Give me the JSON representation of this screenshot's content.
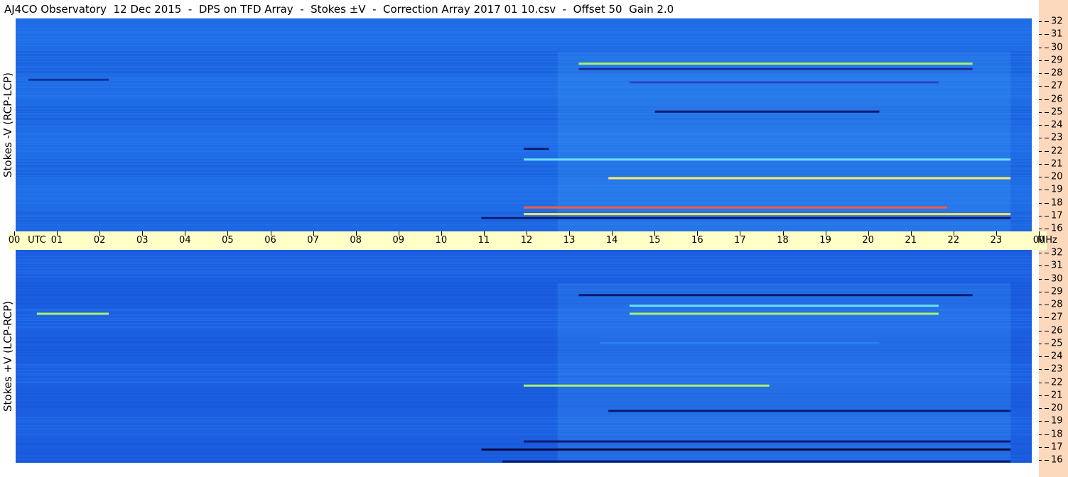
{
  "title": "AJ4CO Observatory  12 Dec 2015  -  DPS on TFD Array  -  Stokes ±V  -  Correction Array 2017 01 10.csv  -  Offset 50  Gain 2.0",
  "chart_data": [
    {
      "type": "heatmap",
      "ylabel": "Stokes -V (RCP-LCP)",
      "y_ticks": [
        "32",
        "31",
        "30",
        "29",
        "28",
        "27",
        "26",
        "25",
        "24",
        "23",
        "22",
        "21",
        "20",
        "19",
        "18",
        "17",
        "16"
      ],
      "ylim": [
        16,
        32
      ],
      "x_ticks": [
        "00",
        "01",
        "02",
        "03",
        "04",
        "05",
        "06",
        "07",
        "08",
        "09",
        "10",
        "11",
        "12",
        "13",
        "14",
        "15",
        "16",
        "17",
        "18",
        "19",
        "20",
        "21",
        "22",
        "23",
        "00"
      ],
      "xlim": [
        0,
        24
      ],
      "background_color": "#1f6de6",
      "features": [
        {
          "t_start": 13.3,
          "t_end": 22.6,
          "f": 28.6,
          "color": "#a8f26b"
        },
        {
          "t_start": 13.3,
          "t_end": 22.6,
          "f": 28.2,
          "color": "#1a2fa0"
        },
        {
          "t_start": 14.5,
          "t_end": 21.8,
          "f": 27.2,
          "color": "#2845c8"
        },
        {
          "t_start": 15.1,
          "t_end": 20.4,
          "f": 25.0,
          "color": "#0a1a70"
        },
        {
          "t_start": 12.0,
          "t_end": 12.6,
          "f": 22.2,
          "color": "#0a1a70"
        },
        {
          "t_start": 12.0,
          "t_end": 23.5,
          "f": 21.4,
          "color": "#6fe0ff"
        },
        {
          "t_start": 14.0,
          "t_end": 23.5,
          "f": 20.0,
          "color": "#ffeb6b"
        },
        {
          "t_start": 12.0,
          "t_end": 22.0,
          "f": 17.8,
          "color": "#ff5a3c"
        },
        {
          "t_start": 12.0,
          "t_end": 23.5,
          "f": 17.3,
          "color": "#ffe35a"
        },
        {
          "t_start": 11.0,
          "t_end": 23.5,
          "f": 17.0,
          "color": "#0a1a70"
        },
        {
          "t_start": 0.3,
          "t_end": 2.2,
          "f": 27.4,
          "color": "#10309a"
        }
      ]
    },
    {
      "type": "heatmap",
      "ylabel": "Stokes +V (LCP-RCP)",
      "y_ticks": [
        "32",
        "31",
        "30",
        "29",
        "28",
        "27",
        "26",
        "25",
        "24",
        "23",
        "22",
        "21",
        "20",
        "19",
        "18",
        "17",
        "16"
      ],
      "ylim": [
        16,
        32
      ],
      "x_ticks": [
        "00",
        "01",
        "02",
        "03",
        "04",
        "05",
        "06",
        "07",
        "08",
        "09",
        "10",
        "11",
        "12",
        "13",
        "14",
        "15",
        "16",
        "17",
        "18",
        "19",
        "20",
        "21",
        "22",
        "23",
        "00"
      ],
      "xlim": [
        0,
        24
      ],
      "background_color": "#1b5fe0",
      "features": [
        {
          "t_start": 13.3,
          "t_end": 22.6,
          "f": 28.6,
          "color": "#0a1a70"
        },
        {
          "t_start": 14.5,
          "t_end": 21.8,
          "f": 27.8,
          "color": "#6fe0ff"
        },
        {
          "t_start": 14.5,
          "t_end": 21.8,
          "f": 27.2,
          "color": "#a8f26b"
        },
        {
          "t_start": 13.8,
          "t_end": 20.4,
          "f": 25.0,
          "color": "#2a80ee"
        },
        {
          "t_start": 12.0,
          "t_end": 17.8,
          "f": 21.8,
          "color": "#a8f26b"
        },
        {
          "t_start": 14.0,
          "t_end": 23.5,
          "f": 19.9,
          "color": "#0a1a70"
        },
        {
          "t_start": 12.0,
          "t_end": 23.5,
          "f": 17.6,
          "color": "#0a1a70"
        },
        {
          "t_start": 11.0,
          "t_end": 23.5,
          "f": 17.0,
          "color": "#050a40"
        },
        {
          "t_start": 11.5,
          "t_end": 23.5,
          "f": 16.1,
          "color": "#0a1a70"
        },
        {
          "t_start": 0.5,
          "t_end": 2.2,
          "f": 27.2,
          "color": "#a8f26b"
        }
      ]
    }
  ],
  "axis": {
    "utc_label": "UTC",
    "mhz_label": "MHz"
  }
}
